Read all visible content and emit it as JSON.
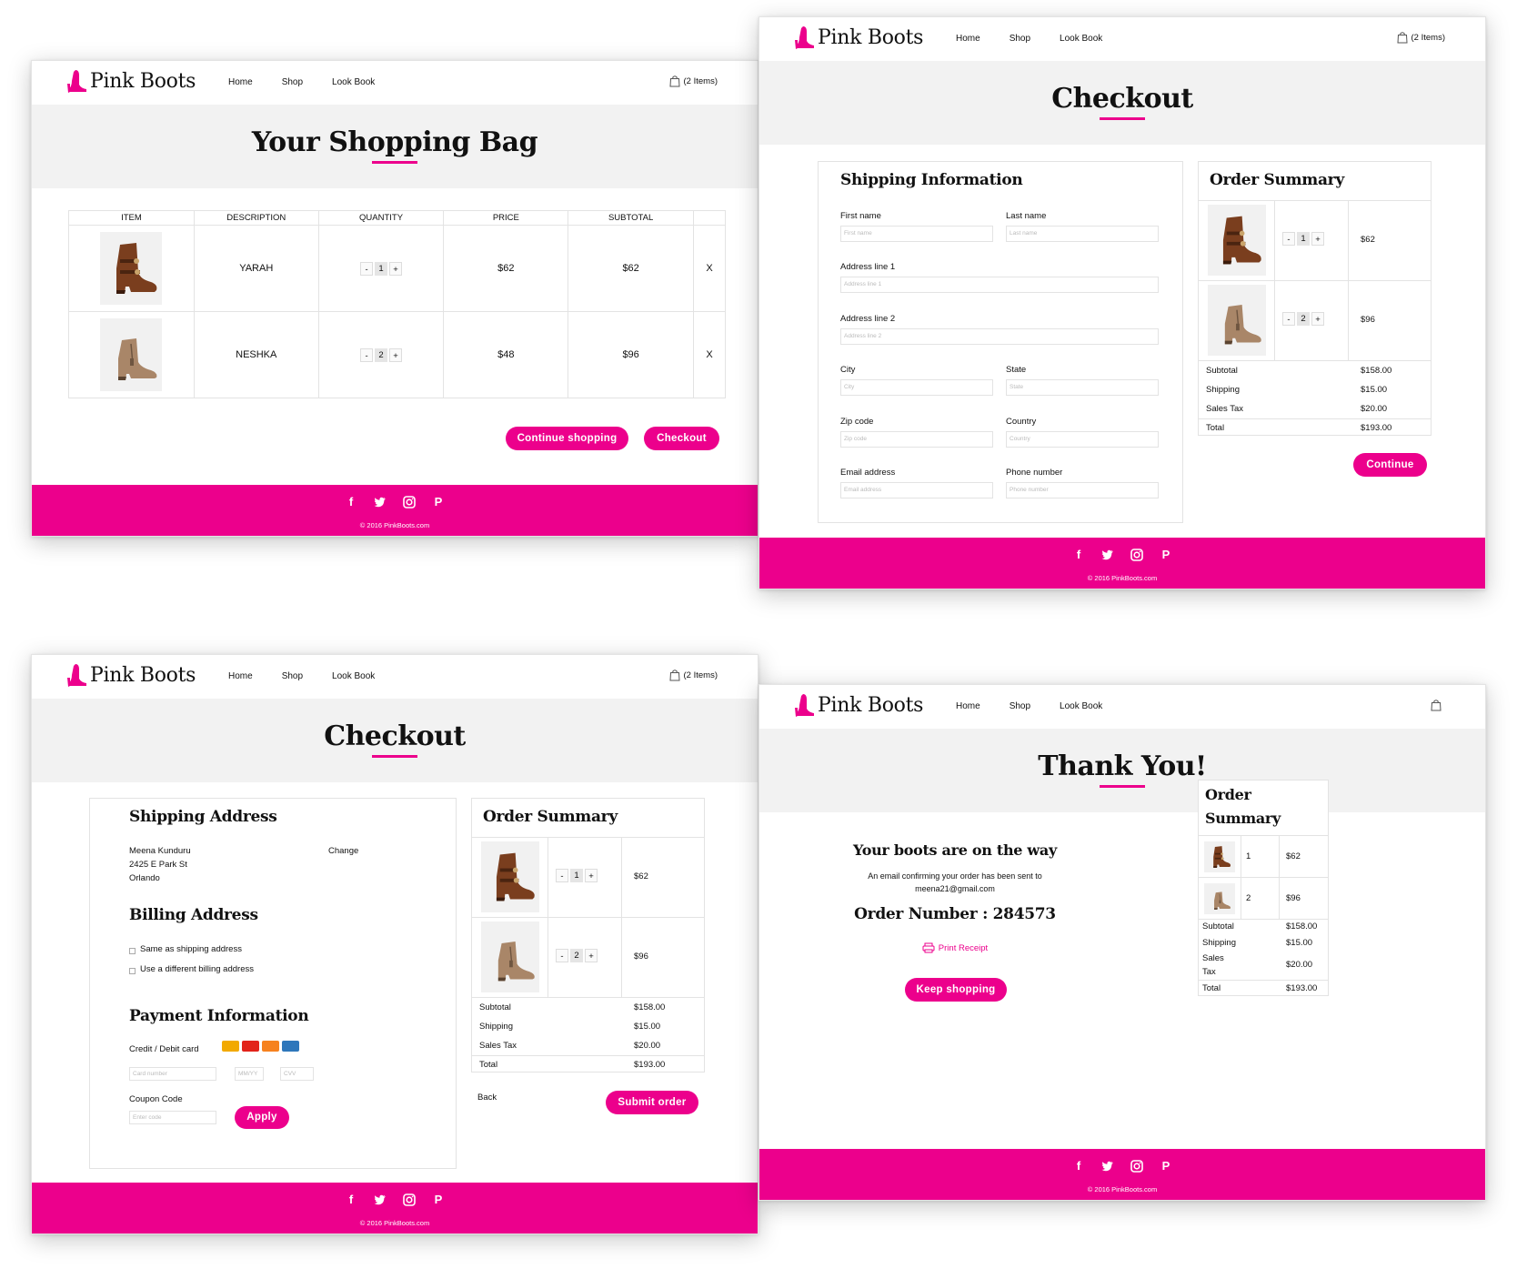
{
  "brand": {
    "name": "Pink Boots",
    "accent": "#ec008c"
  },
  "nav": {
    "home": "Home",
    "shop": "Shop",
    "lookbook": "Look Book",
    "bag": "(2 Items)"
  },
  "footer": {
    "copyright": "© 2016 PinkBoots.com",
    "social": [
      "facebook-icon",
      "twitter-icon",
      "instagram-icon",
      "pinterest-icon"
    ]
  },
  "bag_page": {
    "title": "Your Shopping Bag",
    "headers": [
      "ITEM",
      "DESCRIPTION",
      "QUANTITY",
      "PRICE",
      "SUBTOTAL"
    ],
    "rows": [
      {
        "name": "YARAH",
        "qty": "1",
        "price": "$62",
        "subtotal": "$62",
        "remove": "X"
      },
      {
        "name": "NESHKA",
        "qty": "2",
        "price": "$48",
        "subtotal": "$96",
        "remove": "X"
      }
    ],
    "continue_label": "Continue shopping",
    "checkout_label": "Checkout"
  },
  "checkout1": {
    "title": "Checkout",
    "shipping_title": "Shipping Information",
    "fields": {
      "first_name": {
        "label": "First name",
        "placeholder": "First name"
      },
      "last_name": {
        "label": "Last name",
        "placeholder": "Last name"
      },
      "address1": {
        "label": "Address line 1",
        "placeholder": "Address line 1"
      },
      "address2": {
        "label": "Address line 2",
        "placeholder": "Address line 2"
      },
      "city": {
        "label": "City",
        "placeholder": "City"
      },
      "state": {
        "label": "State",
        "placeholder": "State"
      },
      "zip": {
        "label": "Zip code",
        "placeholder": "Zip code"
      },
      "country": {
        "label": "Country",
        "placeholder": "Country"
      },
      "email": {
        "label": "Email address",
        "placeholder": "Email address"
      },
      "phone": {
        "label": "Phone number",
        "placeholder": "Phone number"
      }
    },
    "continue_label": "Continue"
  },
  "order_summary": {
    "title": "Order Summary",
    "items": [
      {
        "qty": "1",
        "price": "$62"
      },
      {
        "qty": "2",
        "price": "$96"
      }
    ],
    "subtotal_label": "Subtotal",
    "subtotal": "$158.00",
    "shipping_label": "Shipping",
    "shipping": "$15.00",
    "tax_label": "Sales Tax",
    "tax": "$20.00",
    "total_label": "Total",
    "total": "$193.00",
    "qty_minus": "-",
    "qty_plus": "+"
  },
  "checkout2": {
    "title": "Checkout",
    "shipping_address_title": "Shipping Address",
    "address_lines": [
      "Meena Kunduru",
      "2425 E Park St",
      "Orlando"
    ],
    "change_label": "Change",
    "billing_title": "Billing Address",
    "billing_same": "Same as shipping address",
    "billing_diff": "Use a different billing address",
    "payment_title": "Payment Information",
    "card_label": "Credit / Debit card",
    "card_placeholder": "Card number",
    "exp_placeholder": "MM/YY",
    "cvv_placeholder": "CVV",
    "coupon_label": "Coupon Code",
    "coupon_placeholder": "Enter code",
    "apply_label": "Apply",
    "back_label": "Back",
    "submit_label": "Submit order"
  },
  "thanks": {
    "title": "Thank You!",
    "headline": "Your boots are on the way",
    "email_line1": "An email confirming your order has been sent to",
    "email_line2": "meena21@gmail.com",
    "order_number": "Order Number : 284573",
    "print_label": "Print Receipt",
    "keep_label": "Keep shopping",
    "summary_title_1": "Order",
    "summary_title_2": "Summary",
    "tax_line1": "Sales",
    "tax_line2": "Tax"
  }
}
